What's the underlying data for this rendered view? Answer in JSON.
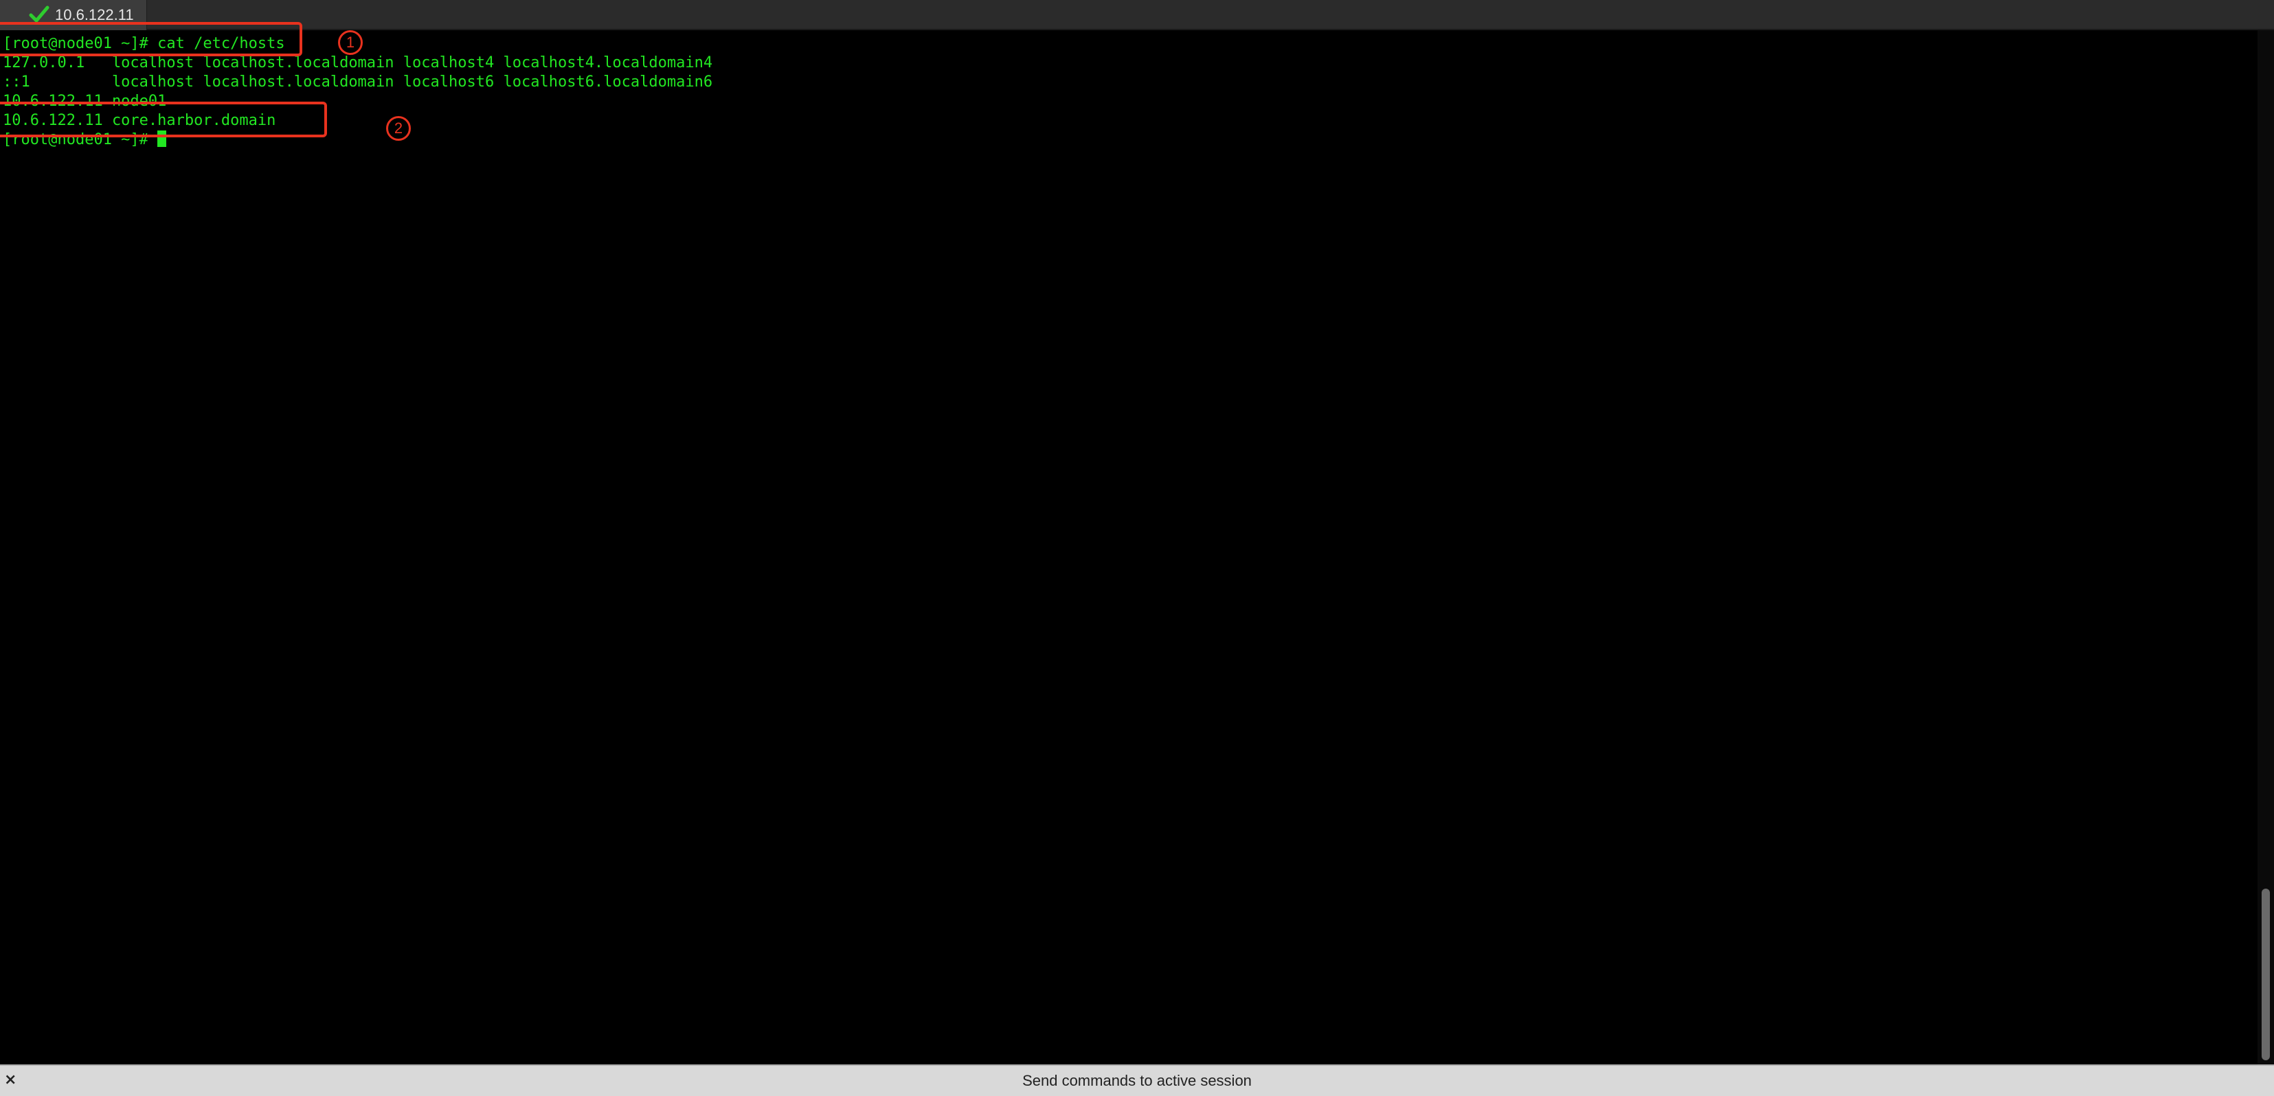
{
  "tab": {
    "title": "10.6.122.11",
    "status_icon": "check-icon",
    "status_color": "#2ecc2e"
  },
  "terminal": {
    "text_color": "#22e622",
    "lines": [
      "[root@node01 ~]# cat /etc/hosts",
      "127.0.0.1   localhost localhost.localdomain localhost4 localhost4.localdomain4",
      "::1         localhost localhost.localdomain localhost6 localhost6.localdomain6",
      "10.6.122.11 node01",
      "10.6.122.11 core.harbor.domain",
      "[root@node01 ~]# "
    ]
  },
  "annotations": {
    "color": "#e8321e",
    "markers": [
      "1",
      "2"
    ]
  },
  "bottom_bar": {
    "close_label": "×",
    "broadcast_placeholder": "Send commands to active session"
  }
}
